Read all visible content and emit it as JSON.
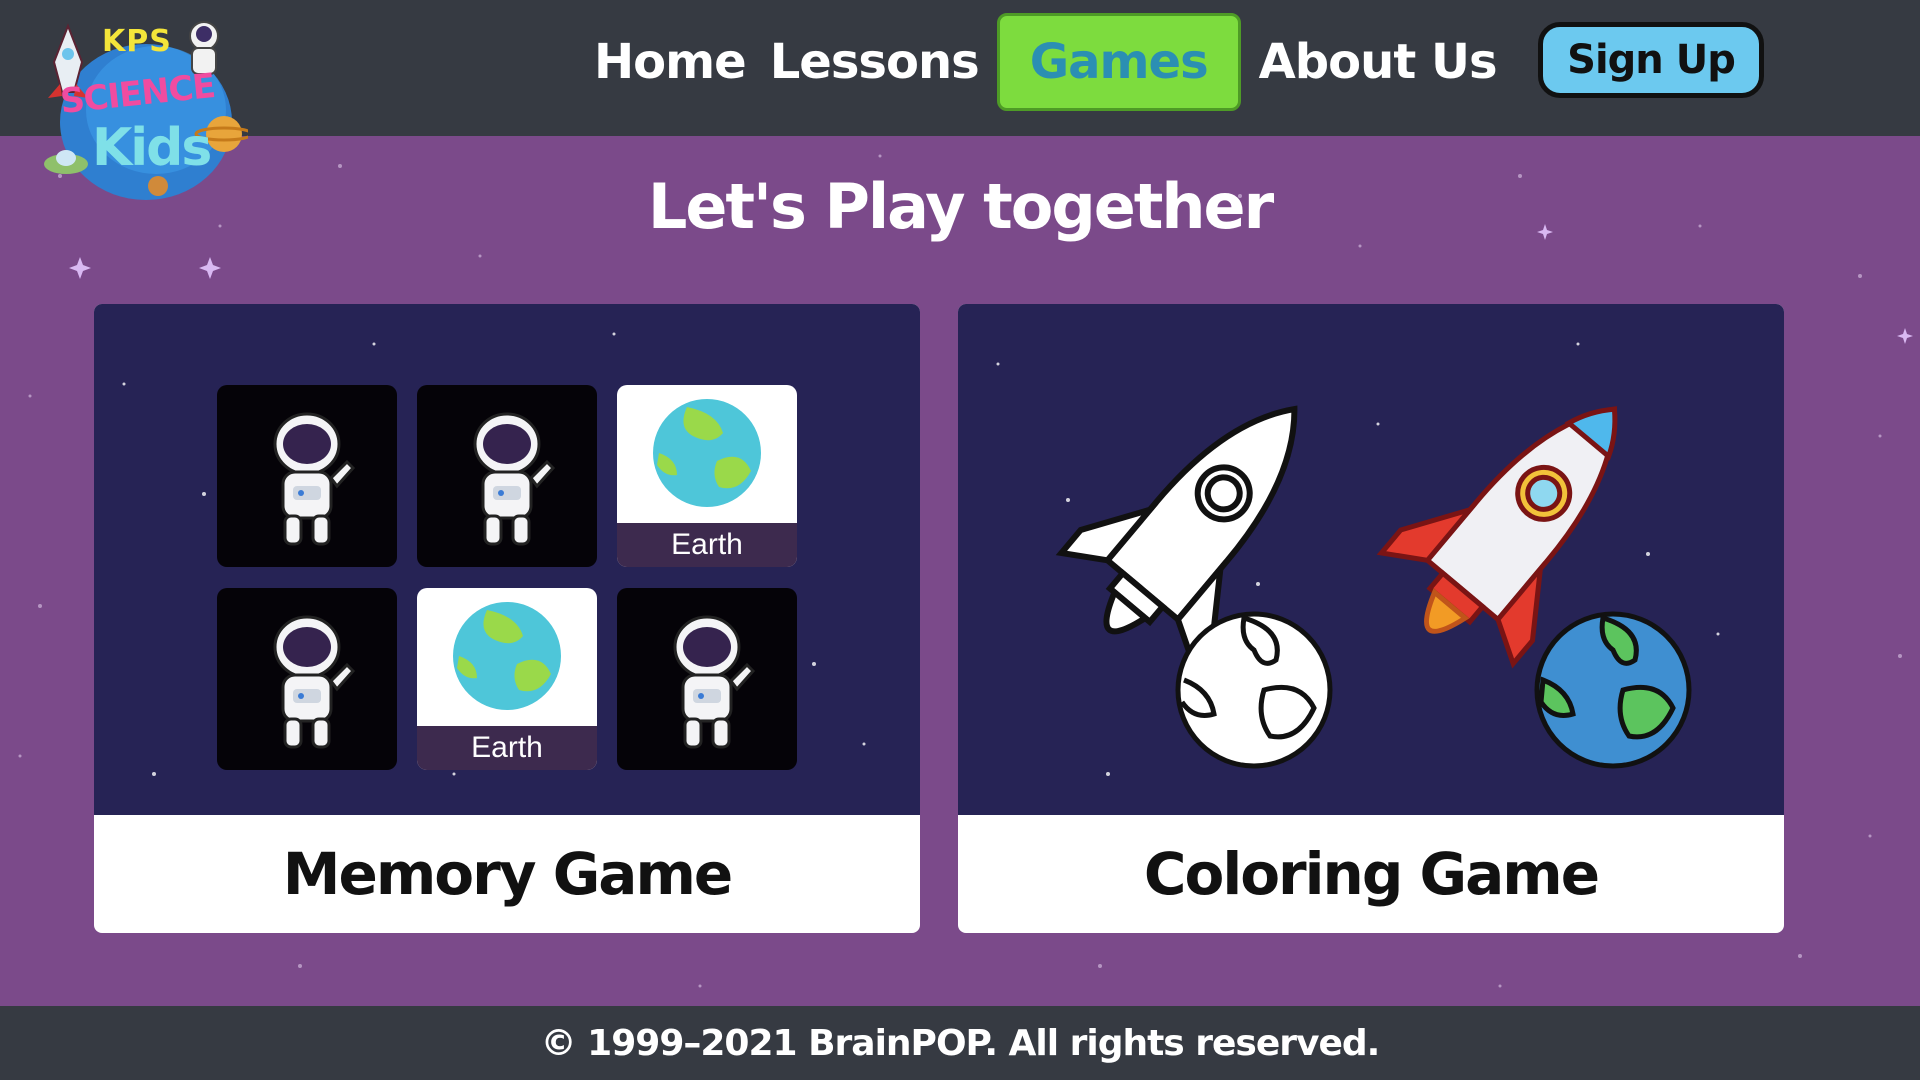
{
  "logo": {
    "line1": "KPS",
    "line2": "SCIENCE",
    "line3": "Kids"
  },
  "nav": {
    "items": [
      {
        "label": "Home"
      },
      {
        "label": "Lessons"
      },
      {
        "label": "Games",
        "active": true
      },
      {
        "label": "About Us"
      }
    ],
    "signup_label": "Sign Up"
  },
  "page": {
    "title": "Let's Play together"
  },
  "games": [
    {
      "label": "Memory Game",
      "tiles": [
        {
          "kind": "astronaut"
        },
        {
          "kind": "astronaut"
        },
        {
          "kind": "earth",
          "caption": "Earth"
        },
        {
          "kind": "astronaut"
        },
        {
          "kind": "earth",
          "caption": "Earth"
        },
        {
          "kind": "astronaut"
        }
      ]
    },
    {
      "label": "Coloring Game"
    }
  ],
  "footer": {
    "text": "© 1999–2021 BrainPOP. All rights reserved."
  },
  "colors": {
    "header": "#363a42",
    "background": "#7b4a8a",
    "card_art": "#262355",
    "active_tab": "#7ddc3e",
    "active_tab_text": "#2b8fb3",
    "signup": "#6cc9ef"
  }
}
